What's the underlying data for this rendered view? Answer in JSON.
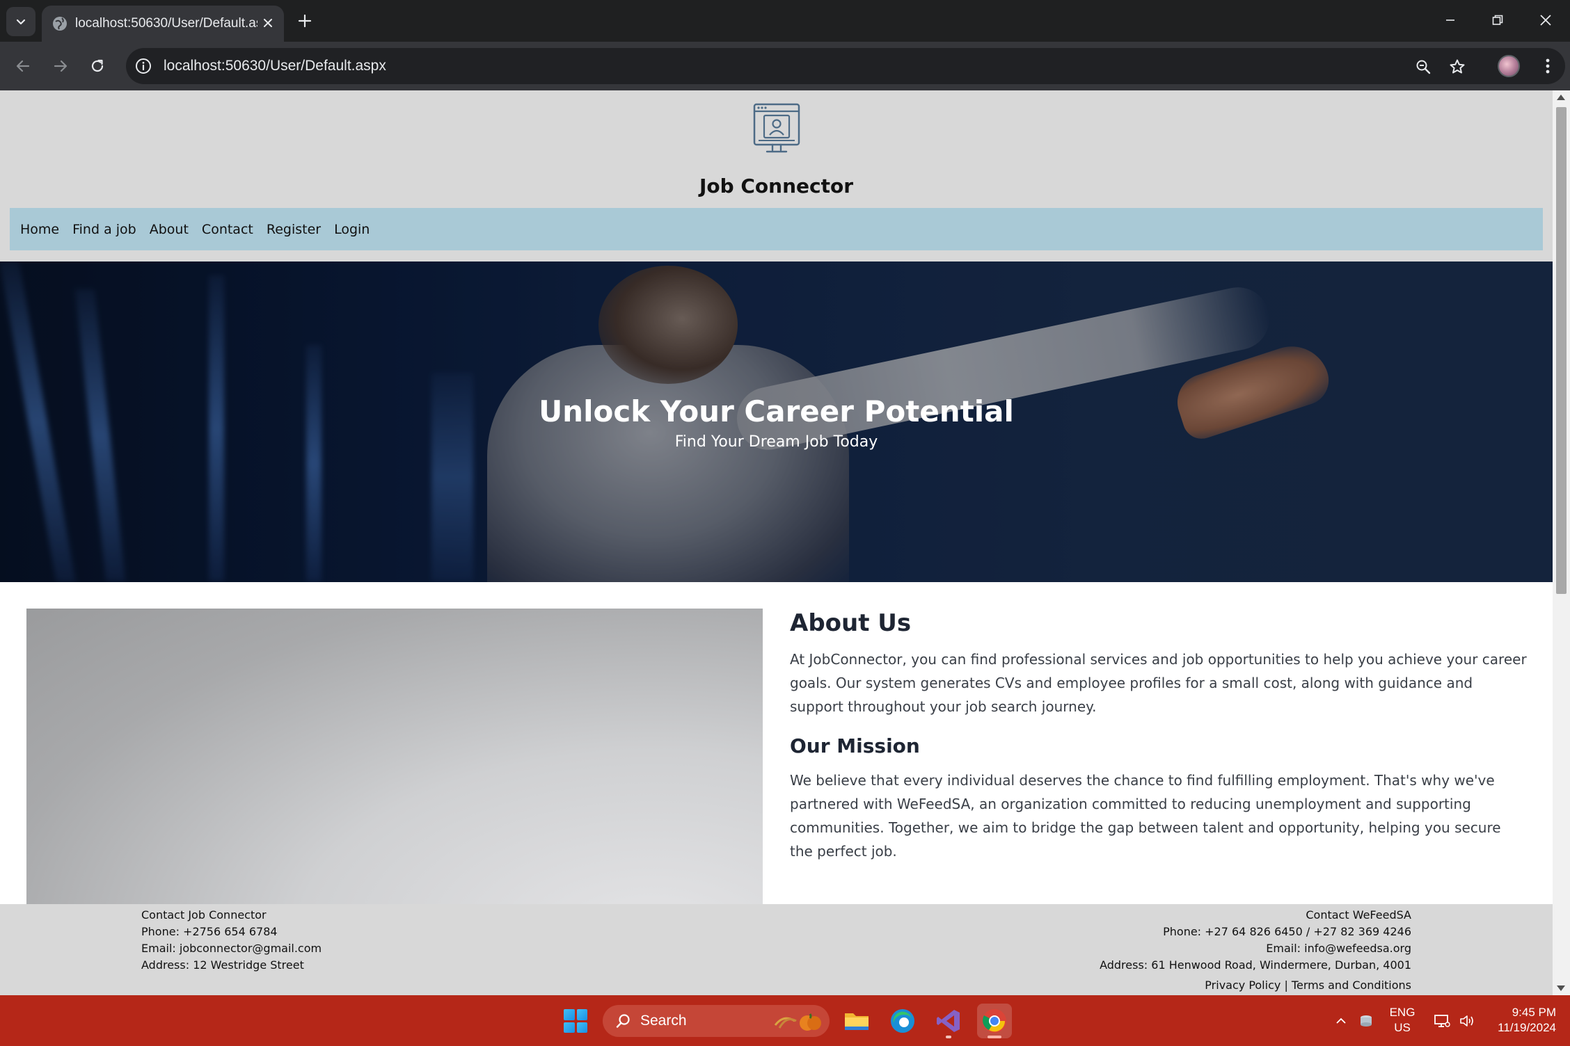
{
  "browser": {
    "tab_title": "localhost:50630/User/Default.aspx",
    "url": "localhost:50630/User/Default.aspx"
  },
  "site": {
    "title": "Job Connector",
    "nav": [
      "Home",
      "Find a job",
      "About",
      "Contact",
      "Register",
      "Login"
    ],
    "hero": {
      "title": "Unlock Your Career Potential",
      "subtitle": "Find Your Dream Job Today"
    },
    "about": {
      "heading": "About Us",
      "text": "At JobConnector, you can find professional services and job opportunities to help you achieve your career goals. Our system generates CVs and employee profiles for a small cost, along with guidance and support throughout your job search journey.",
      "mission_heading": "Our Mission",
      "mission_text": "We believe that every individual deserves the chance to find fulfilling employment. That's why we've partnered with WeFeedSA, an organization committed to reducing unemployment and supporting communities. Together, we aim to bridge the gap between talent and opportunity, helping you secure the perfect job."
    },
    "footer": {
      "left": {
        "heading": "Contact Job Connector",
        "phone": "Phone: +2756 654 6784",
        "email": "Email: jobconnector@gmail.com",
        "address": "Address: 12 Westridge Street"
      },
      "right": {
        "heading": "Contact WeFeedSA",
        "phone": "Phone: +27 64 826 6450 / +27 82 369 4246",
        "email": "Email: info@wefeedsa.org",
        "address": "Address: 61 Henwood Road, Windermere, Durban, 4001"
      },
      "privacy": "Privacy Policy",
      "separator": "|",
      "terms": "Terms and Conditions"
    }
  },
  "taskbar": {
    "search_label": "Search",
    "lang_line1": "ENG",
    "lang_line2": "US",
    "time": "9:45 PM",
    "date": "11/19/2024"
  },
  "colors": {
    "header_bg": "#d8d8d8",
    "nav_bg": "#a9c9d6",
    "taskbar_bg": "#b52718",
    "chrome_dark": "#1f2021",
    "chrome_toolbar": "#35363a"
  }
}
